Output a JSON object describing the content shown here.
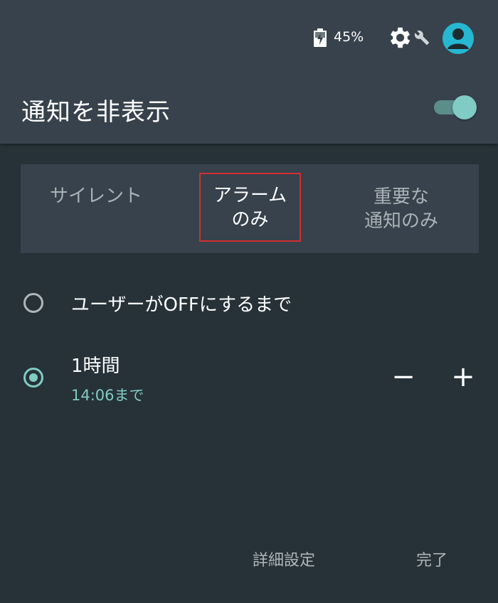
{
  "status": {
    "battery_text": "45%",
    "icons": [
      "battery-charging-icon",
      "gear-icon",
      "wrench-icon",
      "account-icon"
    ],
    "avatar_color": "#26b7d1"
  },
  "header": {
    "title": "通知を非表示",
    "toggle_on": true
  },
  "segments": {
    "silent": "サイレント",
    "alarm_line1": "アラーム",
    "alarm_line2": "のみ",
    "priority_line1": "重要な",
    "priority_line2": "通知のみ",
    "selected": "alarm"
  },
  "options": {
    "until_off": "ユーザーがOFFにするまで",
    "one_hour": "1時間",
    "one_hour_sub": "14:06まで",
    "minus": "−",
    "plus": "+"
  },
  "footer": {
    "advanced": "詳細設定",
    "done": "完了"
  },
  "colors": {
    "background": "#263238",
    "header": "#37424c",
    "accent": "#80cbc4",
    "highlight_border": "#d32f2f"
  }
}
